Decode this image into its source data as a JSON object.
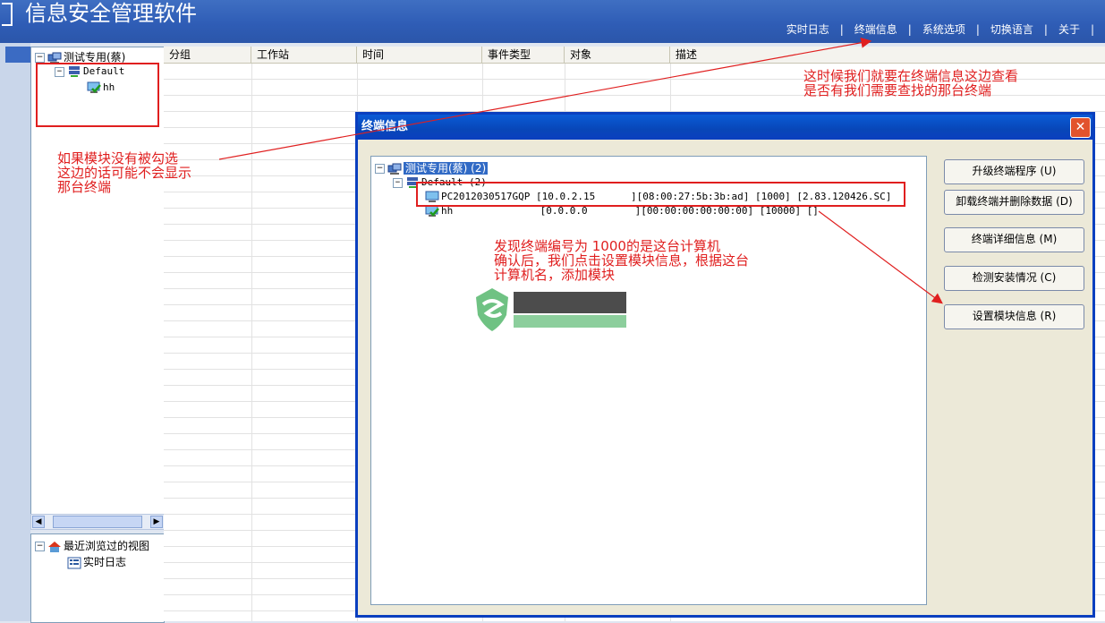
{
  "app": {
    "title": "信息安全管理软件"
  },
  "top_nav": [
    "实时日志",
    "终端信息",
    "系统选项",
    "切换语言",
    "关于"
  ],
  "top_nav_separator": "|",
  "left_tree": {
    "root": "测试专用(蔡)",
    "group": "Default",
    "child": "hh"
  },
  "recent": {
    "title": "最近浏览过的视图",
    "item": "实时日志"
  },
  "grid": {
    "columns": [
      "分组",
      "工作站",
      "时间",
      "事件类型",
      "对象",
      "描述"
    ]
  },
  "dialog": {
    "title": "终端信息",
    "close": "✕",
    "tree": {
      "root": "测试专用(蔡) (2)",
      "group": "Default (2)",
      "terminals": [
        {
          "name": "PC2012030517GQP",
          "ip": "[10.0.2.15",
          "mac": "][08:00:27:5b:3b:ad]",
          "id": "[1000]",
          "version": "[2.83.120426.SC]"
        },
        {
          "name": "hh",
          "ip": "[0.0.0.0",
          "mac": "][00:00:00:00:00:00]",
          "id": "[10000]",
          "version": "[]"
        }
      ]
    },
    "buttons": [
      "升级终端程序 (U)",
      "卸载终端并删除数据 (D)",
      "终端详细信息 (M)",
      "检测安装情况 (C)",
      "设置模块信息 (R)"
    ]
  },
  "annotations": {
    "left": [
      "如果模块没有被勾选",
      "这边的话可能不会显示",
      "那台终端"
    ],
    "top_right": [
      "这时候我们就要在终端信息这边查看",
      "是否有我们需要查找的那台终端"
    ],
    "center": [
      "发现终端编号为 1000的是这台计算机",
      "确认后，我们点击设置模块信息，根据这台",
      "计算机名，添加模块"
    ]
  },
  "colors": {
    "accent_blue": "#0a3fbf",
    "annotation_red": "#e01f1f",
    "titlebar_blue": "#2f5db6"
  }
}
